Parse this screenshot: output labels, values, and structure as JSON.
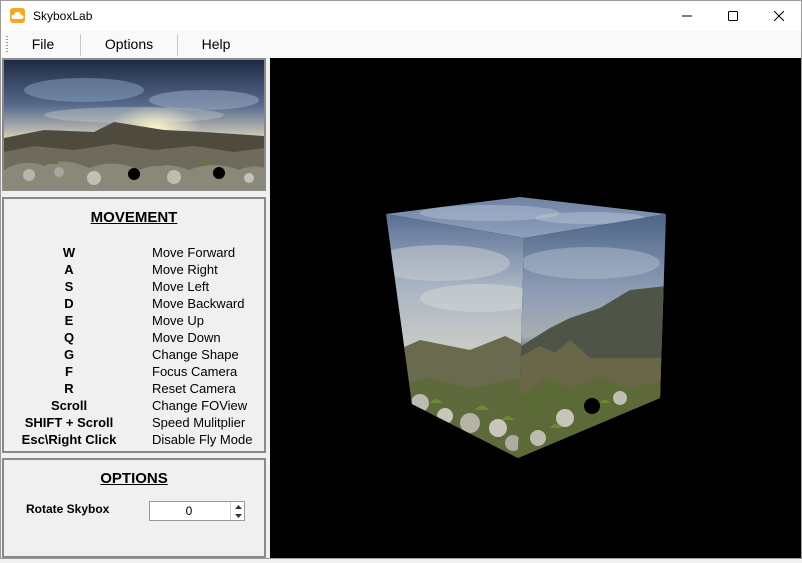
{
  "window": {
    "title": "SkyboxLab"
  },
  "menu": {
    "items": [
      "File",
      "Options",
      "Help"
    ]
  },
  "movement": {
    "heading": "MOVEMENT",
    "bindings": [
      {
        "key": "W",
        "action": "Move Forward"
      },
      {
        "key": "A",
        "action": "Move Right"
      },
      {
        "key": "S",
        "action": "Move Left"
      },
      {
        "key": "D",
        "action": "Move Backward"
      },
      {
        "key": "E",
        "action": "Move Up"
      },
      {
        "key": "Q",
        "action": "Move Down"
      },
      {
        "key": "G",
        "action": "Change Shape"
      },
      {
        "key": "F",
        "action": "Focus Camera"
      },
      {
        "key": "R",
        "action": "Reset Camera"
      },
      {
        "key": "Scroll",
        "action": "Change FOView"
      },
      {
        "key": "SHIFT + Scroll",
        "action": "Speed Mulitplier"
      },
      {
        "key": "Esc\\Right Click",
        "action": "Disable Fly Mode"
      }
    ]
  },
  "options": {
    "heading": "OPTIONS",
    "rotate_label": "Rotate Skybox",
    "rotate_value": "0"
  },
  "colors": {
    "app_icon": "#f5a623",
    "viewport_bg": "#000000",
    "group_border": "#8a8a8a"
  },
  "icons": {
    "app": "cloud-icon",
    "minimize": "minimize-icon",
    "maximize": "maximize-icon",
    "close": "close-icon",
    "spin_up": "chevron-up-icon",
    "spin_down": "chevron-down-icon"
  }
}
